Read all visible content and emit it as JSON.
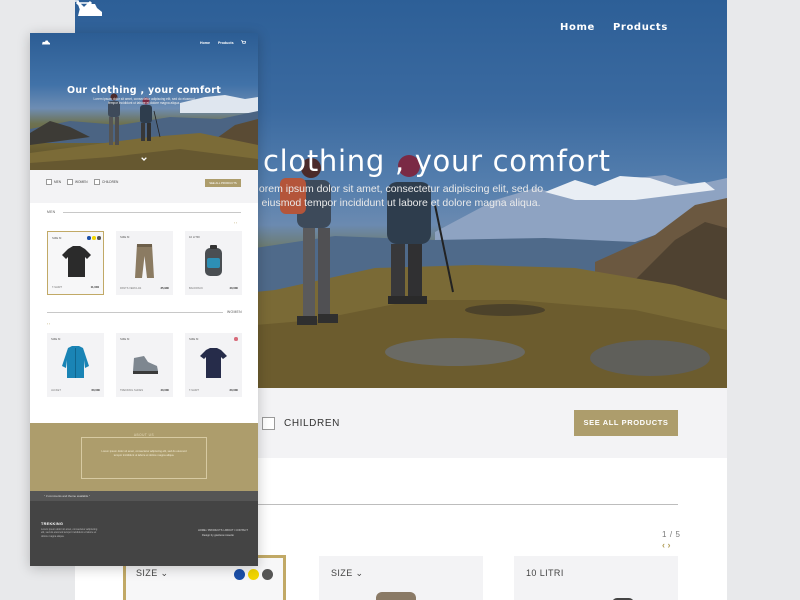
{
  "nav": {
    "home": "Home",
    "products": "Products"
  },
  "hero": {
    "title_big": "clothing , your comfort",
    "title_full": "Our clothing , your comfort",
    "subtitle_big": "orem ipsum dolor sit amet, consectetur adipiscing elit, sed do eiusmod tempor incididunt ut labore et dolore magna aliqua.",
    "subtitle_small": "Lorem ipsum dolor sit amet, consectetur adipiscing elit, sed do eiusmod tempor incididunt ut labore et dolore magna aliqua."
  },
  "filters": {
    "men": "MEN",
    "women": "WOMEN",
    "children": "CHILDREN",
    "see_all": "SEE ALL PRODUCTS",
    "see_all_small": "SEE ALL PRODUCTS"
  },
  "sections": {
    "men": "MEN",
    "women": "WOMEN",
    "page_indicator": "1 / 5",
    "pager": "‹ ›"
  },
  "big_cards": [
    {
      "label": "SIZE ⌄"
    },
    {
      "label": "SIZE ⌄"
    },
    {
      "label": "10 LITRI"
    }
  ],
  "color_dots": [
    "#1b4fa8",
    "#f2d600",
    "#555555"
  ],
  "products_men": [
    {
      "size": "SIZE M",
      "name": "T-SHIRT",
      "price": "11,00€"
    },
    {
      "size": "SIZE M",
      "name": "PANTS VERCLAS",
      "price": "35,90€"
    },
    {
      "size": "10 LITRI",
      "name": "BACKPACK",
      "price": "40,00€"
    }
  ],
  "products_women": [
    {
      "size": "SIZE M",
      "name": "JACKET",
      "price": "60,00€"
    },
    {
      "size": "SIZE M",
      "name": "TREKKING SHOES",
      "price": "40,00€"
    },
    {
      "size": "SIZE M",
      "name": "T-SHIRT",
      "price": "20,00€"
    }
  ],
  "about": {
    "title": "ABOUT US",
    "text": "Lorem ipsum dolor sit amet, consectetur adipiscing elit, sed do eiusmod tempor incididunt ut labore et dolore magna aliqua."
  },
  "bar_text": "\" 3 comments and theme available \"",
  "footer": {
    "brand": "TREKKING",
    "text": "Lorem ipsum dolor sit amet, consectetur adipiscing elit, sed do eiusmod tempor incididunt ut labore et dolore magna aliqua.",
    "links": "HOME / PRODUCTS / ABOUT / CONTACT",
    "design": "Design by gianluca rossetto"
  }
}
